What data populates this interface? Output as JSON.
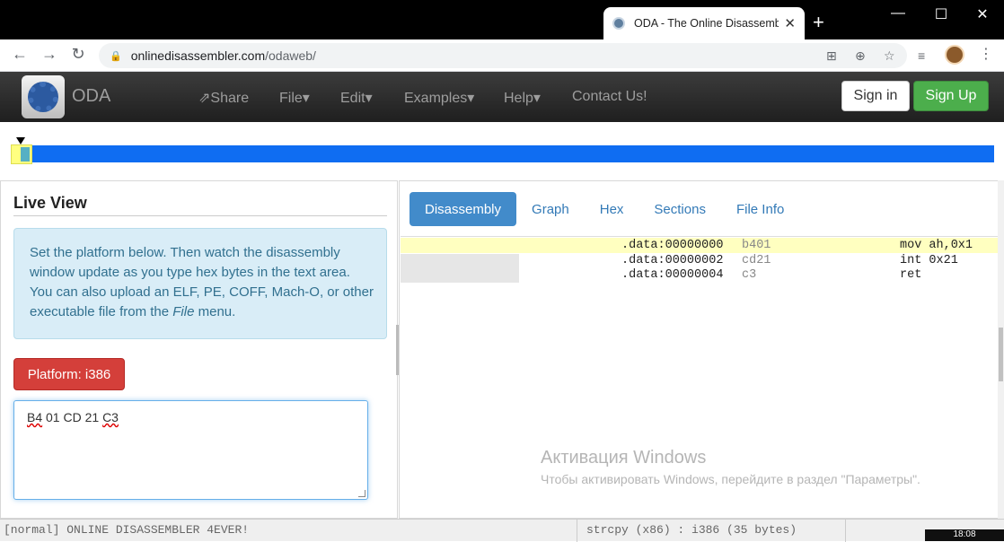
{
  "browser": {
    "tab_title": "ODA - The Online Disassembl",
    "url_host": "onlinedisassembler.com",
    "url_path": "/odaweb/",
    "new_tab": "+",
    "win_minimize": "—",
    "win_maximize": "☐",
    "win_close": "✕"
  },
  "navbar": {
    "brand": "ODA",
    "items": [
      "Share",
      "File",
      "Edit",
      "Examples",
      "Help",
      "Contact Us!"
    ],
    "sign_in": "Sign in",
    "sign_up": "Sign Up"
  },
  "live_view": {
    "title": "Live View",
    "info_text_1": "Set the platform below. Then watch the disassembly window update as you type hex bytes in the text area. You can also upload an ELF, PE, COFF, Mach-O, or other executable file from the ",
    "info_text_em": "File",
    "info_text_2": " menu.",
    "platform_button": "Platform: i386",
    "hex_b4": "B4",
    "hex_mid": " 01 CD 21 ",
    "hex_c3": "C3"
  },
  "tabs": [
    "Disassembly",
    "Graph",
    "Hex",
    "Sections",
    "File Info"
  ],
  "active_tab": "Disassembly",
  "disassembly": [
    {
      "addr": ".data:00000000",
      "bytes": "b401",
      "instr": "mov ah,0x1"
    },
    {
      "addr": ".data:00000002",
      "bytes": "cd21",
      "instr": "int 0x21"
    },
    {
      "addr": ".data:00000004",
      "bytes": "c3",
      "instr": "ret"
    }
  ],
  "watermark": {
    "line1": "Активация Windows",
    "line2": "Чтобы активировать Windows, перейдите в раздел \"Параметры\"."
  },
  "status": {
    "left": "[normal] ONLINE DISASSEMBLER 4EVER!",
    "mid": "strcpy (x86) : i386 (35 bytes)",
    "clock": "18:08"
  },
  "colors": {
    "strip_blue": "#0f6df2",
    "active_tab": "#428bca",
    "platform_red": "#d43f3a",
    "signup_green": "#4cae4c"
  }
}
